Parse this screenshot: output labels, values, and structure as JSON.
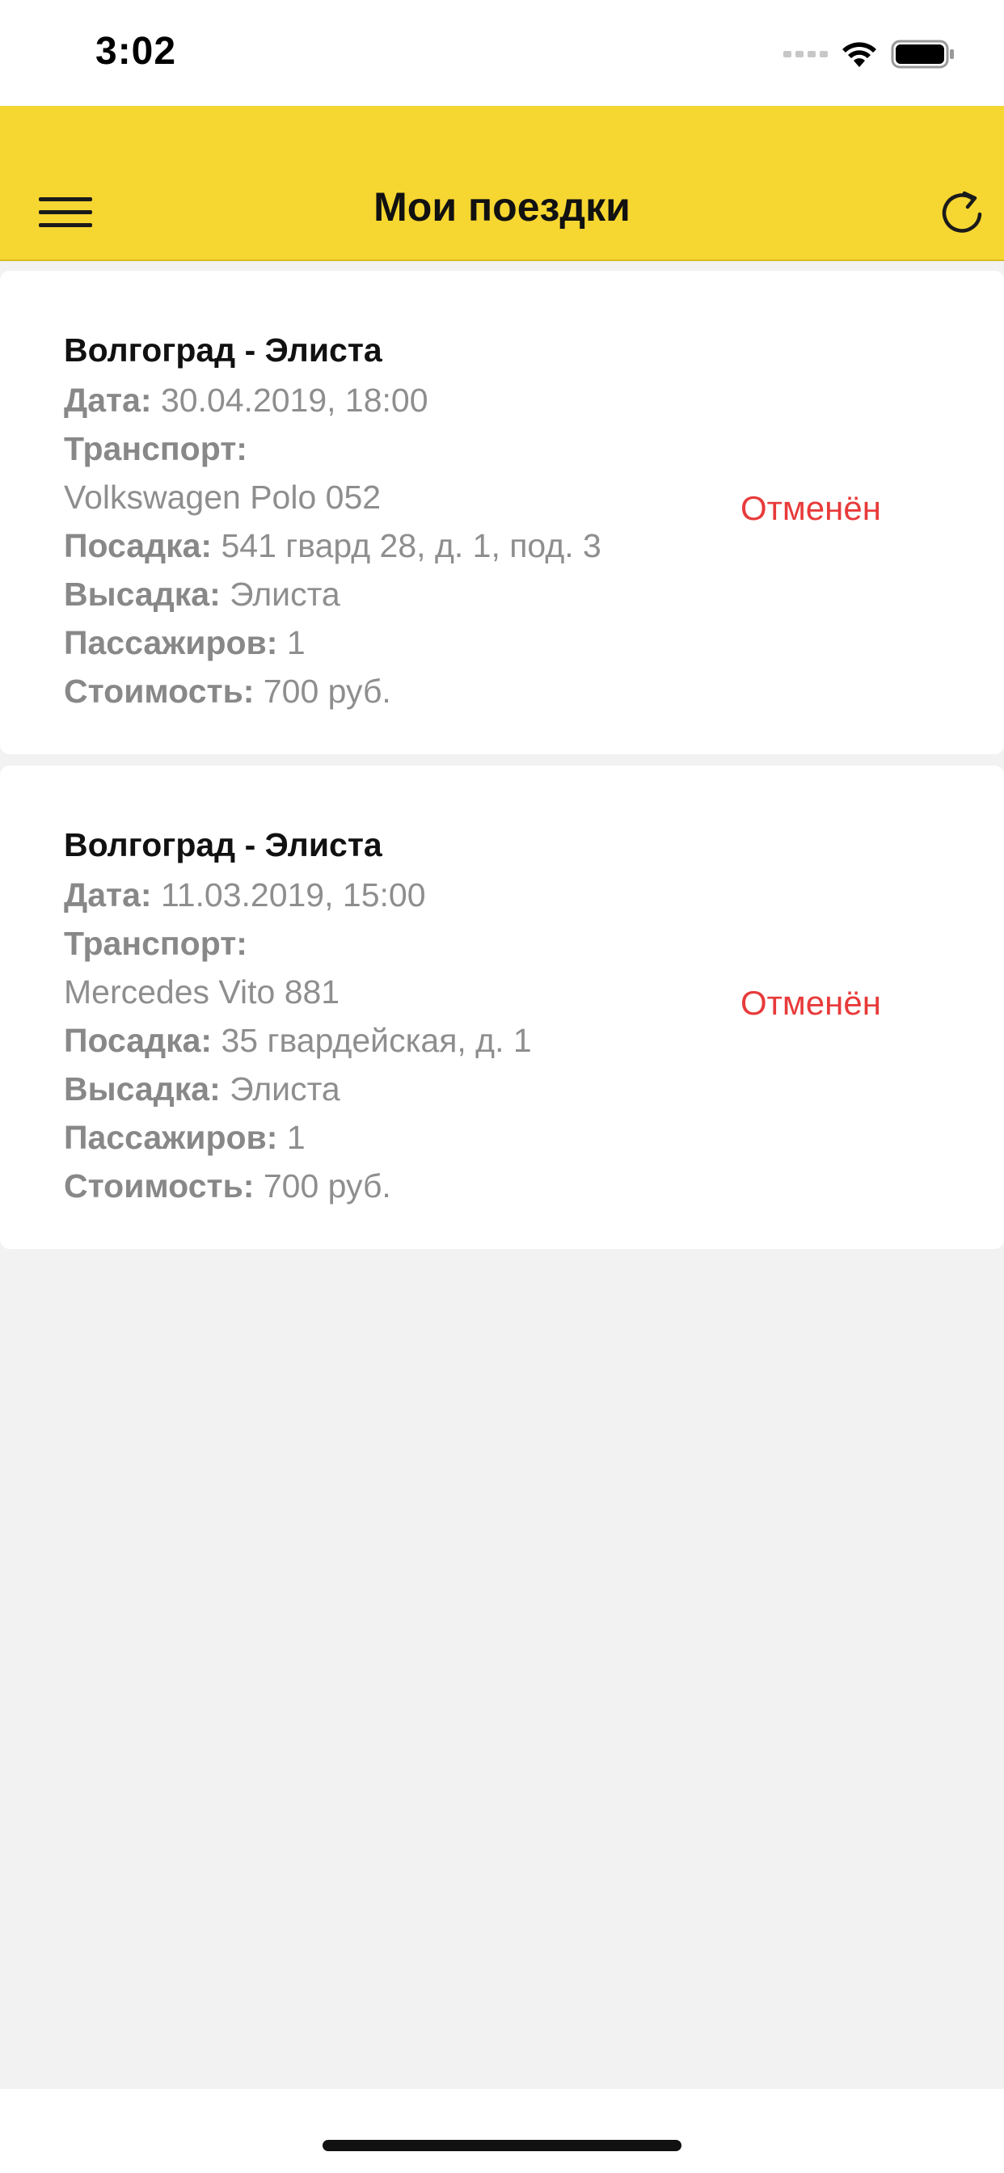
{
  "status_bar": {
    "time": "3:02"
  },
  "header": {
    "title": "Мои поездки"
  },
  "labels": {
    "date": "Дата:",
    "transport": "Транспорт:",
    "boarding": "Посадка:",
    "dropoff": "Высадка:",
    "passengers": "Пассажиров:",
    "cost": "Стоимость:"
  },
  "trips": [
    {
      "route": "Волгоград - Элиста",
      "date": "30.04.2019, 18:00",
      "transport": "Volkswagen Polo 052",
      "boarding": "541 гвард 28, д. 1, под. 3",
      "dropoff": "Элиста",
      "passengers": "1",
      "cost": "700 руб.",
      "status": "Отменён"
    },
    {
      "route": "Волгоград - Элиста",
      "date": "11.03.2019, 15:00",
      "transport": "Mercedes Vito 881",
      "boarding": "35 гвардейская, д. 1",
      "dropoff": "Элиста",
      "passengers": "1",
      "cost": "700 руб.",
      "status": "Отменён"
    }
  ],
  "colors": {
    "header_bg": "#f6d631",
    "status_cancelled": "#e83a3a",
    "background": "#f2f2f2"
  },
  "icons": {
    "menu": "hamburger-menu-icon",
    "refresh": "refresh-icon",
    "wifi": "wifi-icon",
    "battery": "battery-icon",
    "signal": "cellular-signal-icon"
  }
}
